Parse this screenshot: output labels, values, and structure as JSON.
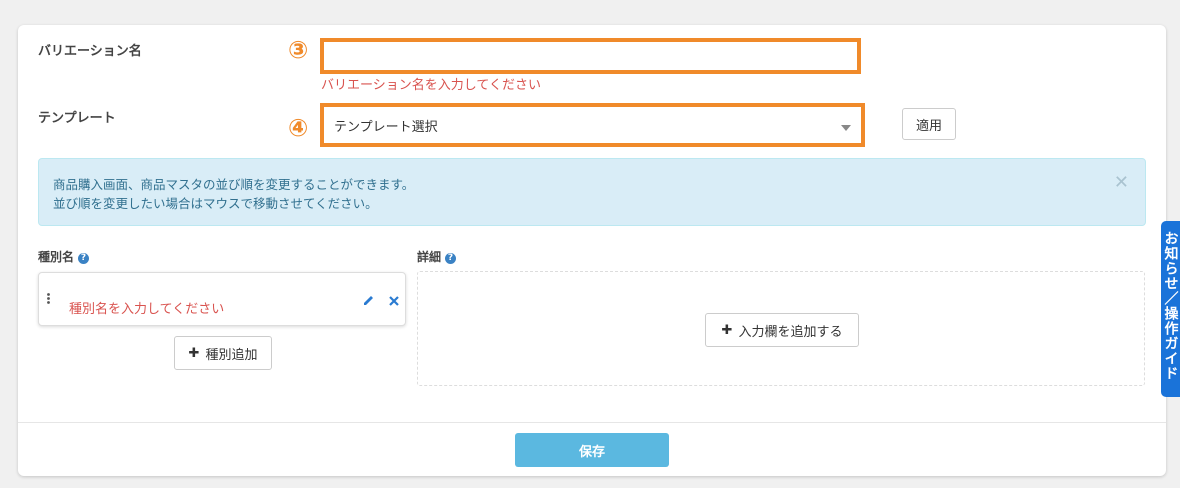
{
  "form": {
    "variation_label": "バリエーション名",
    "variation_marker": "③",
    "variation_value": "",
    "variation_error": "バリエーション名を入力してください",
    "template_label": "テンプレート",
    "template_marker": "④",
    "template_selected": "テンプレート選択",
    "apply_label": "適用"
  },
  "alert": {
    "line1": "商品購入画面、商品マスタの並び順を変更することができます。",
    "line2": "並び順を変更したい場合はマウスで移動させてください。"
  },
  "types": {
    "header": "種別名",
    "item_placeholder": "種別名を入力してください",
    "add_label": "種別追加"
  },
  "details": {
    "header": "詳細",
    "add_label": "入力欄を追加する"
  },
  "footer": {
    "save_label": "保存"
  },
  "side_tab": {
    "label": "お知らせ／操作ガイド"
  },
  "colors": {
    "highlight": "#f08a2a",
    "error": "#d9534f",
    "save_button": "#5bb8e0",
    "side_tab": "#1a73d9"
  }
}
